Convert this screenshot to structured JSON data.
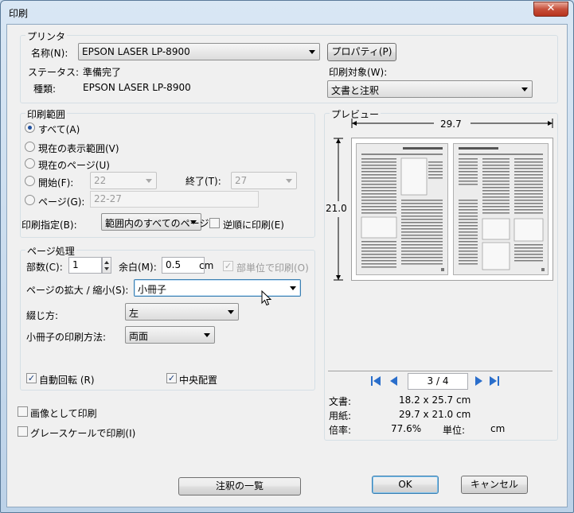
{
  "window": {
    "title": "印刷",
    "close_glyph": "✕"
  },
  "printer": {
    "group_label": "プリンタ",
    "name_label": "名称(N):",
    "name_value": "EPSON LASER LP-8900",
    "properties_button": "プロパティ(P)",
    "status_label": "ステータス:",
    "status_value": "準備完了",
    "type_label": "種類:",
    "type_value": "EPSON LASER LP-8900",
    "target_label": "印刷対象(W):",
    "target_value": "文書と注釈"
  },
  "range": {
    "group_label": "印刷範囲",
    "all": "すべて(A)",
    "current_view": "現在の表示範囲(V)",
    "current_page": "現在のページ(U)",
    "start_label": "開始(F):",
    "start_value": "22",
    "end_label": "終了(T):",
    "end_value": "27",
    "pages_label": "ページ(G):",
    "pages_value": "22-27",
    "subset_label": "印刷指定(B):",
    "subset_value": "範囲内のすべてのページ",
    "reverse_label": "逆順に印刷(E)"
  },
  "handling": {
    "group_label": "ページ処理",
    "copies_label": "部数(C):",
    "copies_value": "1",
    "margin_label": "余白(M):",
    "margin_value": "0.5",
    "margin_unit": "cm",
    "collate_label": "部単位で印刷(O)",
    "scaling_label": "ページの拡大 / 縮小(S):",
    "scaling_value": "小冊子",
    "binding_label": "綴じ方:",
    "binding_value": "左",
    "booklet_label": "小冊子の印刷方法:",
    "booklet_value": "両面",
    "auto_rotate": "自動回転 (R)",
    "center": "中央配置"
  },
  "options": {
    "as_image": "画像として印刷",
    "grayscale": "グレースケールで印刷(I)"
  },
  "preview": {
    "group_label": "プレビュー",
    "width_dim": "29.7",
    "height_dim": "21.0",
    "page_indicator": "3 / 4",
    "doc_label": "文書:",
    "doc_value": "18.2 x 25.7 cm",
    "paper_label": "用紙:",
    "paper_value": "29.7 x 21.0 cm",
    "scale_label": "倍率:",
    "scale_value": "77.6%",
    "unit_label": "単位:",
    "unit_value": "cm"
  },
  "buttons": {
    "annotations": "注釈の一覧",
    "ok": "OK",
    "cancel": "キャンセル"
  },
  "checked_glyph": "✓"
}
